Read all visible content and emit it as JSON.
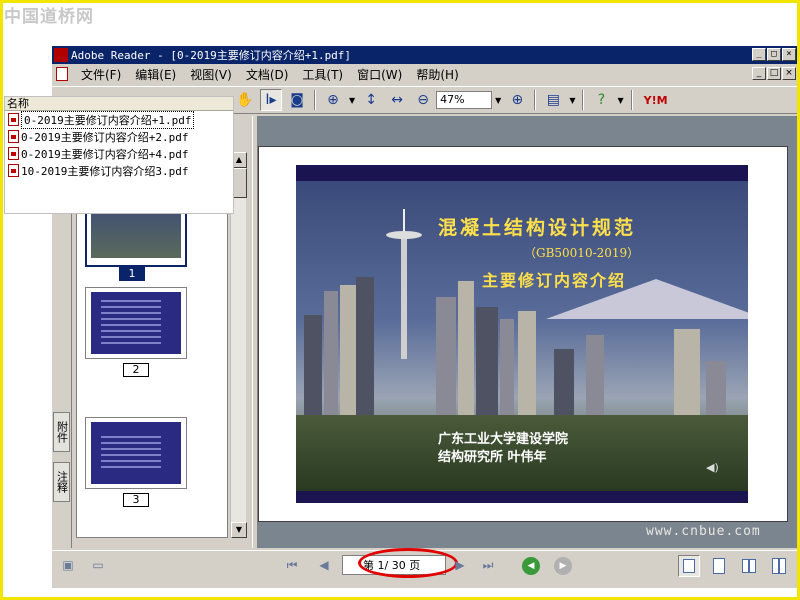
{
  "watermark": {
    "top_left": "中国道桥网",
    "bottom_right": "www.cnbue.com"
  },
  "window": {
    "title": "Adobe Reader - [0-2019主要修订内容介绍+1.pdf]",
    "btn_min": "_",
    "btn_max": "□",
    "btn_close": "×"
  },
  "menu": {
    "items": [
      "文件(F)",
      "编辑(E)",
      "视图(V)",
      "文档(D)",
      "工具(T)",
      "窗口(W)",
      "帮助(H)"
    ]
  },
  "toolbar": {
    "zoom_value": "47%"
  },
  "file_list": {
    "header": "名称",
    "files": [
      "0-2019主要修订内容介绍+1.pdf",
      "0-2019主要修订内容介绍+2.pdf",
      "0-2019主要修订内容介绍+4.pdf",
      "10-2019主要修订内容介绍3.pdf"
    ]
  },
  "sidebar": {
    "tabs": [
      "附件",
      "注释"
    ],
    "thumbnails": [
      "1",
      "2",
      "3"
    ]
  },
  "slide": {
    "title": "混凝土结构设计规范",
    "code": "（GB50010-2019）",
    "subtitle": "主要修订内容介绍",
    "organization": "广东工业大学建设学院",
    "author": "结构研究所      叶伟年"
  },
  "status": {
    "page_indicator": "第 1/ 30 页"
  },
  "colors": {
    "title_bar": "#0a246a",
    "slide_text": "#ffe04a",
    "highlight_oval": "#e00000",
    "frame": "#f2e600"
  },
  "icons": [
    "hand-icon",
    "select-text-icon",
    "snapshot-icon",
    "zoom-in-icon",
    "fit-height-icon",
    "fit-width-icon",
    "zoom-out-icon",
    "zoom-plus-icon",
    "page-tools-icon",
    "help-icon",
    "yahoo-icon"
  ]
}
